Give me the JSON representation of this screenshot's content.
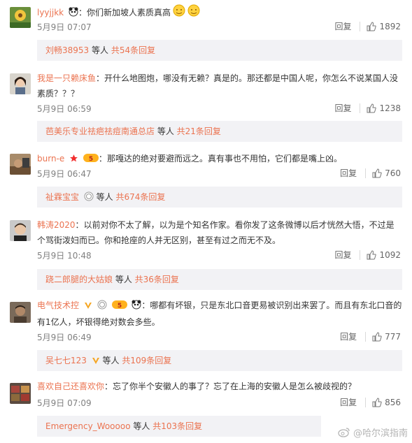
{
  "comments": [
    {
      "username": "lyyjjkk",
      "badges": [
        "panda-emoji",
        "hug-emoji",
        "hug-emoji"
      ],
      "text": "你们新加坡人素质真高",
      "time": "5月9日 07:07",
      "reply_label": "回复",
      "likes": "1892",
      "replies": {
        "name": "刘畅38953",
        "middle": " 等人 ",
        "count": "共54条回复"
      }
    },
    {
      "username": "我是一只赖床鱼",
      "badges": [],
      "text": "开什么地图炮，哪没有无赖？真是的。那还都是中国人呢，你怎么不说某国人没素质？？？",
      "time": "5月9日 06:59",
      "reply_label": "回复",
      "likes": "1238",
      "replies": {
        "name": "芭美乐专业祛疤祛痘南通总店",
        "middle": " 等人 ",
        "count": "共21条回复"
      }
    },
    {
      "username": "burn-e",
      "badges": [
        "star-badge",
        "vip-badge"
      ],
      "text": "那嘎达的绝对要避而远之。真有事也不用怕，它们都是嘴上凶。",
      "time": "5月9日 06:47",
      "reply_label": "回复",
      "likes": "760",
      "replies": {
        "name": "祉霖宝宝",
        "middle": " 等人 ",
        "count": "共674条回复"
      }
    },
    {
      "username": "韩涛2020",
      "badges": [],
      "text": "以前对你不太了解，以为是个知名作家。看你发了这条微博以后才恍然大悟，不过是个骂街泼妇而已。你和抢座的人并无区别，甚至有过之而无不及。",
      "time": "5月9日 10:48",
      "reply_label": "回复",
      "likes": "1092",
      "replies": {
        "name": "跷二郎腿的大姑娘",
        "middle": " 等人 ",
        "count": "共36条回复"
      }
    },
    {
      "username": "电气技术控",
      "badges": [
        "verified-v-badge",
        "medal-badge",
        "vip-badge",
        "panda-emoji"
      ],
      "text": "哪都有坏银，只是东北口音更易被识别出来罢了。而且有东北口音的有1亿人，坏银得绝对数会多些。",
      "time": "5月9日 06:49",
      "reply_label": "回复",
      "likes": "777",
      "replies": {
        "name": "吴七七123",
        "middle": " 等人 ",
        "count": "共109条回复"
      }
    },
    {
      "username": "喜欢自己还喜欢你",
      "badges": [],
      "text": "忘了你半个安徽人的事了？忘了在上海的安徽人是怎么被歧视的？",
      "time": "5月9日 07:09",
      "reply_label": "回复",
      "likes": "856",
      "replies": {
        "name": "Emergency_Wooooo",
        "middle": " 等人 ",
        "count": "共103条回复"
      }
    }
  ],
  "watermark": "@哈尔滨指南",
  "colors": {
    "accent": "#eb7350",
    "meta": "#808080",
    "reply_bg": "#f2f2f5"
  }
}
